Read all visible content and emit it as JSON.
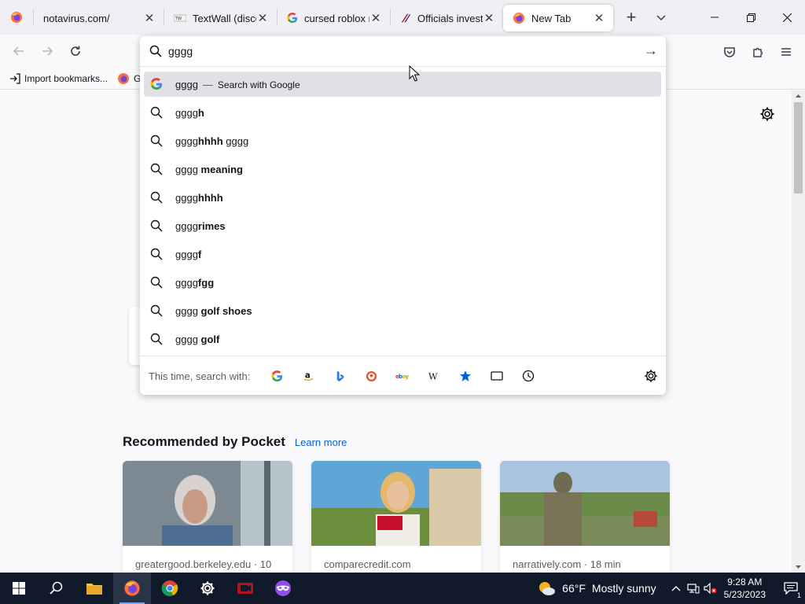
{
  "tabs": [
    {
      "title": "notavirus.com/",
      "icon": "globe-icon",
      "active": false
    },
    {
      "title": "TextWall (discon",
      "icon": "textwall-icon",
      "active": false
    },
    {
      "title": "cursed roblox m",
      "icon": "google-icon",
      "active": false
    },
    {
      "title": "Officials investig",
      "icon": "news-icon",
      "active": false
    },
    {
      "title": "New Tab",
      "icon": "firefox-icon",
      "active": true
    }
  ],
  "tab_close_glyph": "✕",
  "new_tab_glyph": "+",
  "list_tabs_glyph": "⌄",
  "window": {
    "minimize": "—",
    "restore": "❐",
    "close": "✕"
  },
  "urlbar": {
    "value": "gggg",
    "go_glyph": "→"
  },
  "suggestions": [
    {
      "typed": "gggg",
      "rest": "",
      "sep": "—",
      "action": "Search with Google",
      "icon": "google-icon",
      "selected": true
    },
    {
      "typed": "gggg",
      "rest": "h",
      "icon": "search-icon"
    },
    {
      "typed": "gggg",
      "rest": "hhhh",
      "tail": " gggg",
      "icon": "search-icon"
    },
    {
      "typed": "gggg ",
      "rest": "meaning",
      "icon": "search-icon"
    },
    {
      "typed": "gggg",
      "rest": "hhhh",
      "icon": "search-icon"
    },
    {
      "typed": "gggg",
      "rest": "rimes",
      "icon": "search-icon"
    },
    {
      "typed": "gggg",
      "rest": "f",
      "icon": "search-icon"
    },
    {
      "typed": "gggg",
      "rest": "fgg",
      "icon": "search-icon"
    },
    {
      "typed": "gggg ",
      "rest": "golf shoes",
      "icon": "search-icon"
    },
    {
      "typed": "gggg ",
      "rest": "golf",
      "icon": "search-icon"
    }
  ],
  "oneoff": {
    "label": "This time, search with:",
    "engines": [
      "google",
      "amazon",
      "bing",
      "duckduckgo",
      "ebay",
      "wikipedia",
      "bookmarks",
      "tabs",
      "history"
    ]
  },
  "bookmarks_bar": {
    "import_label": "Import bookmarks...",
    "second_initial": "G"
  },
  "pocket": {
    "title": "Recommended by Pocket",
    "learn_more": "Learn more",
    "cards": [
      {
        "source": "greatergood.berkeley.edu · 10"
      },
      {
        "source": "comparecredit.com"
      },
      {
        "source": "narratively.com · 18 min"
      }
    ]
  },
  "taskbar": {
    "weather_temp": "66°F",
    "weather_text": "Mostly sunny",
    "time": "9:28 AM",
    "date": "5/23/2023",
    "notification_count": "1",
    "tray_chevron": "^"
  },
  "colors": {
    "accent": "#0061e0",
    "taskbar": "#101a2b",
    "firefox_orange": "#ff7139"
  }
}
